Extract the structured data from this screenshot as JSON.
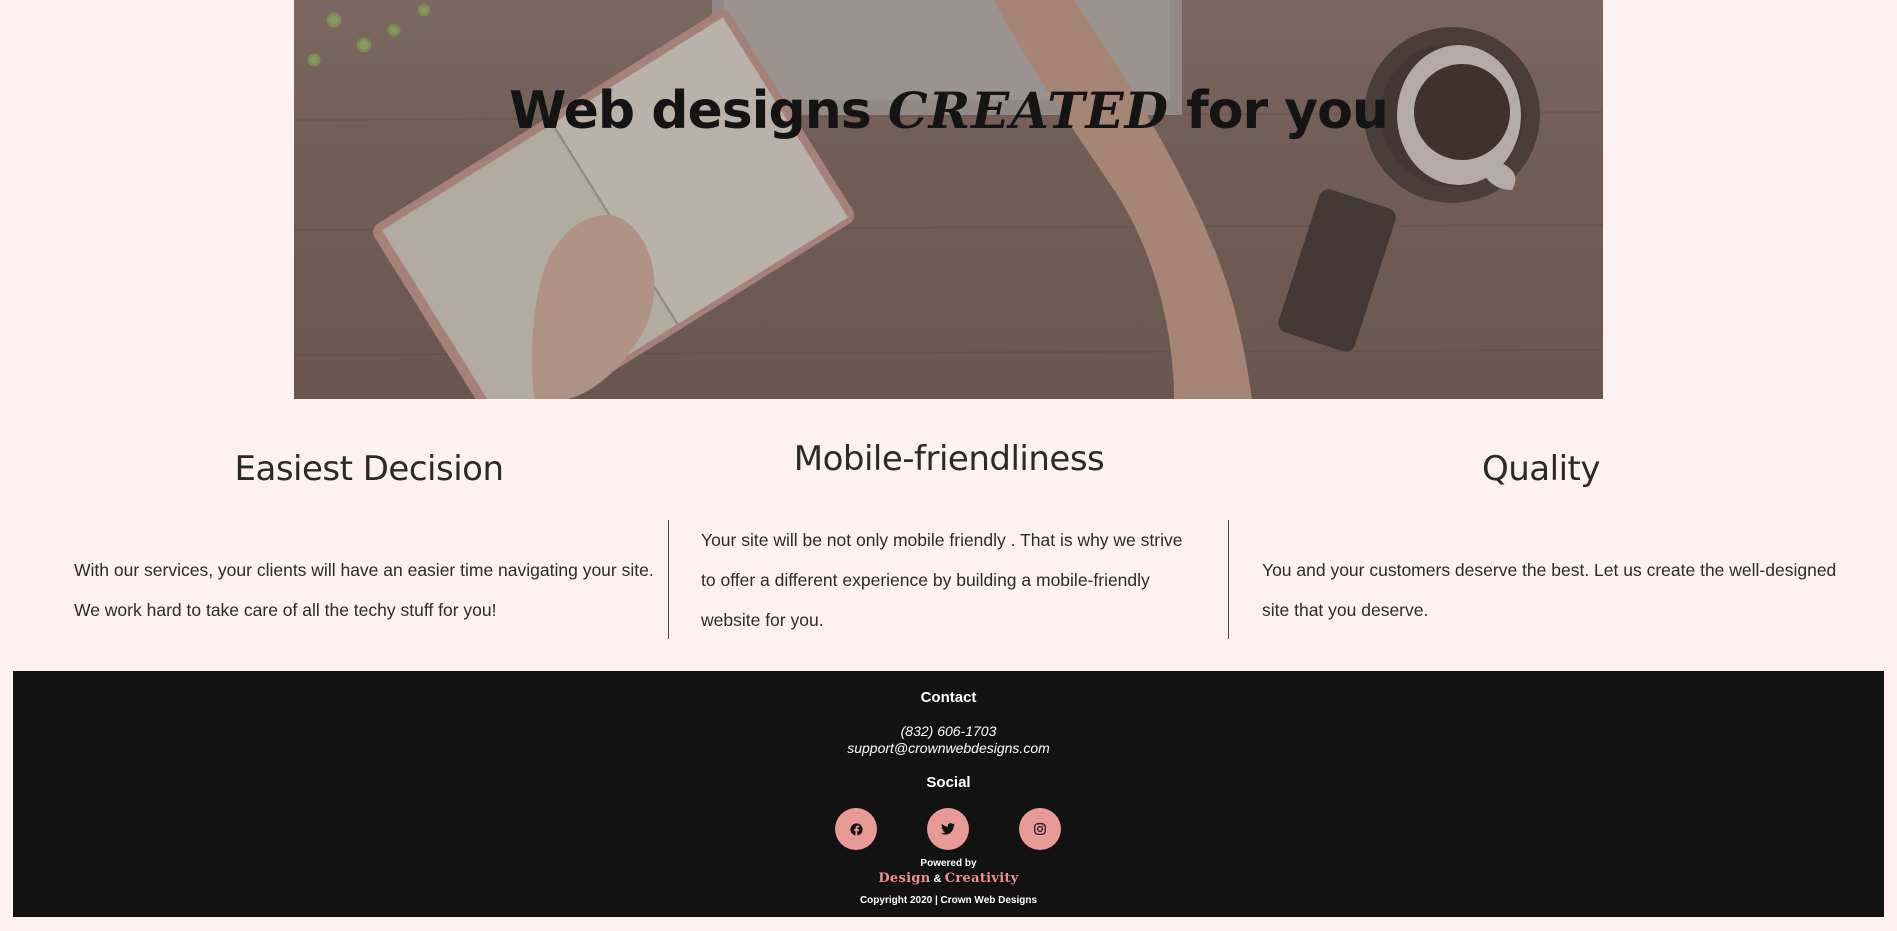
{
  "hero": {
    "title_before": "Web designs ",
    "title_accent": "CREATED",
    "title_after": " for you"
  },
  "features": [
    {
      "title": "Easiest Decision",
      "text": "With our services, your clients will have an easier time navigating your site. We work hard to take care of all the techy stuff for you!"
    },
    {
      "title": "Mobile-friendliness",
      "text": "Your site will be not only mobile friendly . That is why we strive to offer a different experience by building a mobile-friendly website for you."
    },
    {
      "title": "Quality",
      "text": "You and your customers deserve the best. Let us create the well-designed site that you deserve."
    }
  ],
  "footer": {
    "contact_heading": "Contact",
    "phone": "(832) 606-1703",
    "email": "support@crownwebdesigns.com",
    "social_heading": "Social",
    "social": [
      {
        "name": "Facebook",
        "icon": "facebook-icon"
      },
      {
        "name": "Twitter",
        "icon": "twitter-icon"
      },
      {
        "name": "Instagram",
        "icon": "instagram-icon"
      }
    ],
    "powered_by": "Powered by",
    "brand_part1": "Design",
    "brand_amp": "&",
    "brand_part2": "Creativity",
    "copyright": "Copyright 2020 | Crown Web Designs"
  },
  "colors": {
    "page_background": "#fdf2f1",
    "footer_background": "#121212",
    "accent": "#e89a97",
    "brand_text": "#f0908c"
  }
}
